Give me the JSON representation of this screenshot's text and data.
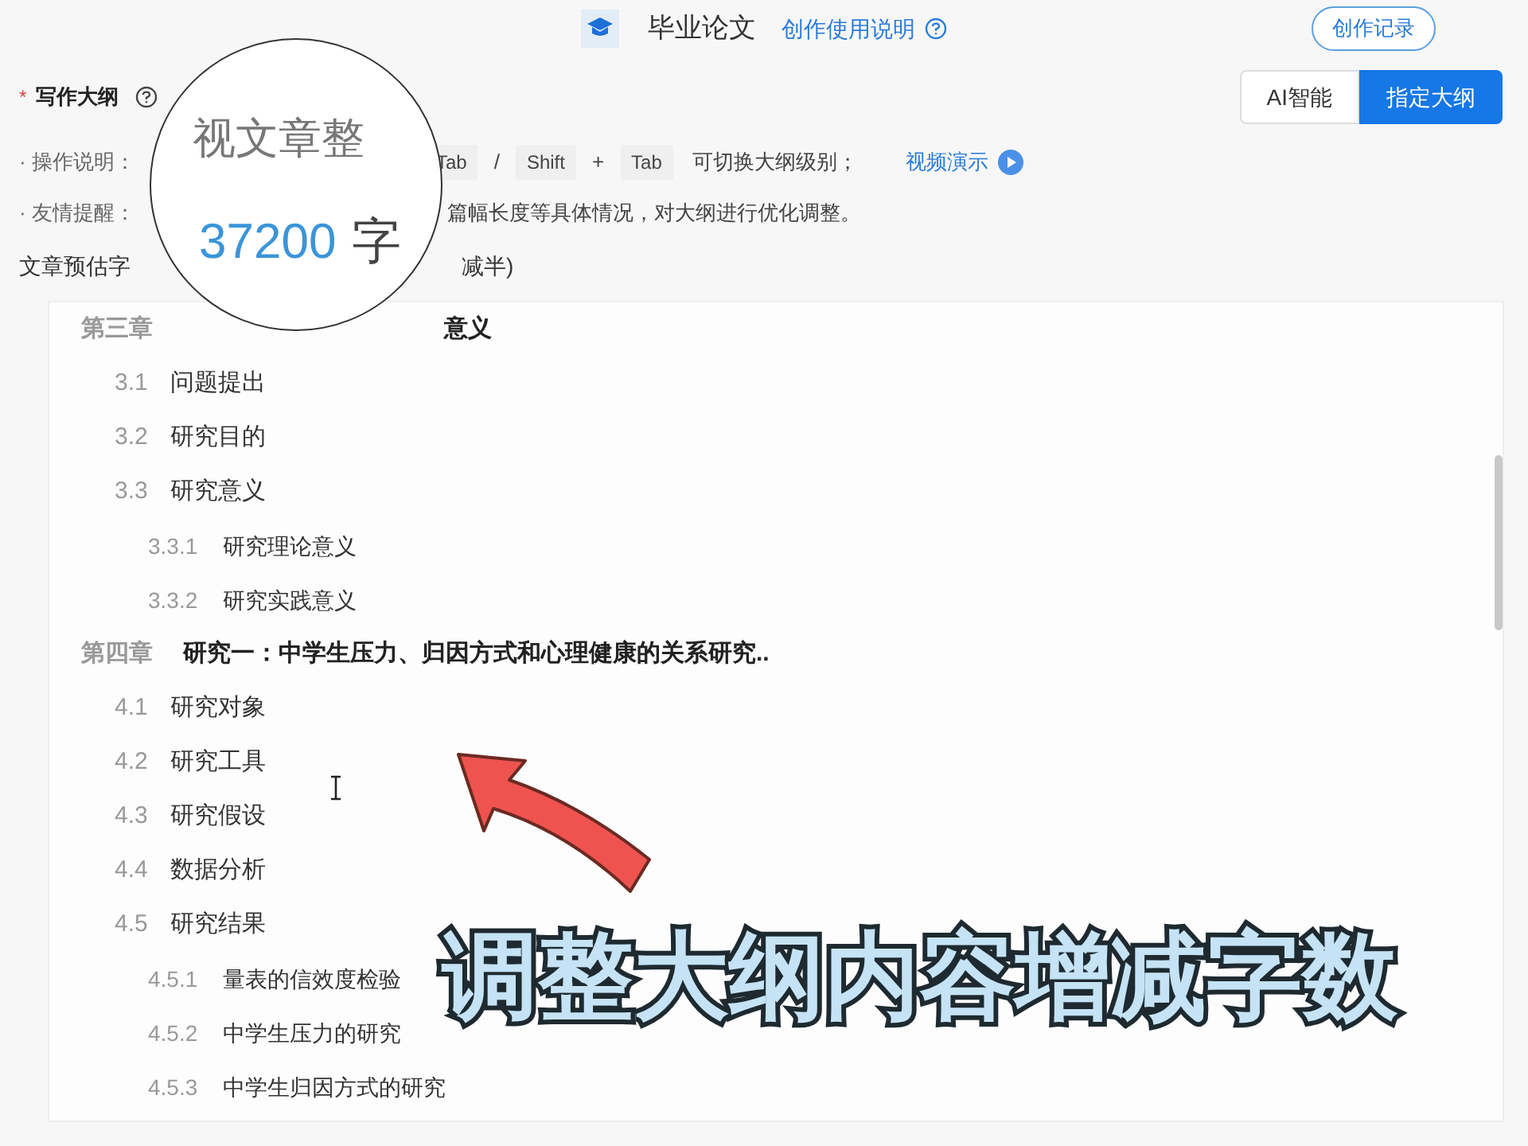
{
  "header": {
    "title": "毕业论文",
    "help_link": "创作使用说明",
    "history_button": "创作记录"
  },
  "section": {
    "required_mark": "*",
    "title": "写作大纲"
  },
  "mode_tabs": [
    {
      "label": "AI智能",
      "selected": false
    },
    {
      "label": "指定大纲",
      "selected": true
    }
  ],
  "instructions": {
    "label": "· 操作说明：",
    "parts": [
      {
        "kind": "key",
        "text": "Tab"
      },
      {
        "kind": "sep",
        "text": "/"
      },
      {
        "kind": "key",
        "text": "Shift"
      },
      {
        "kind": "sep",
        "text": "+"
      },
      {
        "kind": "key",
        "text": "Tab"
      },
      {
        "kind": "text",
        "text": "可切换大纲级别；"
      }
    ],
    "video_link": "视频演示"
  },
  "reminder": {
    "label": "· 友情提醒：",
    "text": "篇幅长度等具体情况，对大纲进行优化调整。"
  },
  "word_count": {
    "label": "文章预估字",
    "note": "减半)"
  },
  "outline": [
    {
      "number": "第三章",
      "title": "意义",
      "children": [
        {
          "number": "3.1",
          "title": "问题提出"
        },
        {
          "number": "3.2",
          "title": "研究目的"
        },
        {
          "number": "3.3",
          "title": "研究意义",
          "children": [
            {
              "number": "3.3.1",
              "title": "研究理论意义"
            },
            {
              "number": "3.3.2",
              "title": "研究实践意义"
            }
          ]
        }
      ]
    },
    {
      "number": "第四章",
      "title": "研究一：中学生压力、归因方式和心理健康的关系研究..",
      "children": [
        {
          "number": "4.1",
          "title": "研究对象"
        },
        {
          "number": "4.2",
          "title": "研究工具"
        },
        {
          "number": "4.3",
          "title": "研究假设"
        },
        {
          "number": "4.4",
          "title": "数据分析"
        },
        {
          "number": "4.5",
          "title": "研究结果",
          "children": [
            {
              "number": "4.5.1",
              "title": "量表的信效度检验"
            },
            {
              "number": "4.5.2",
              "title": "中学生压力的研究"
            },
            {
              "number": "4.5.3",
              "title": "中学生归因方式的研究"
            }
          ]
        }
      ]
    }
  ],
  "magnifier": {
    "top_text": "视文章整",
    "count": "37200",
    "unit": "字"
  },
  "caption": "调整大纲内容增减字数"
}
